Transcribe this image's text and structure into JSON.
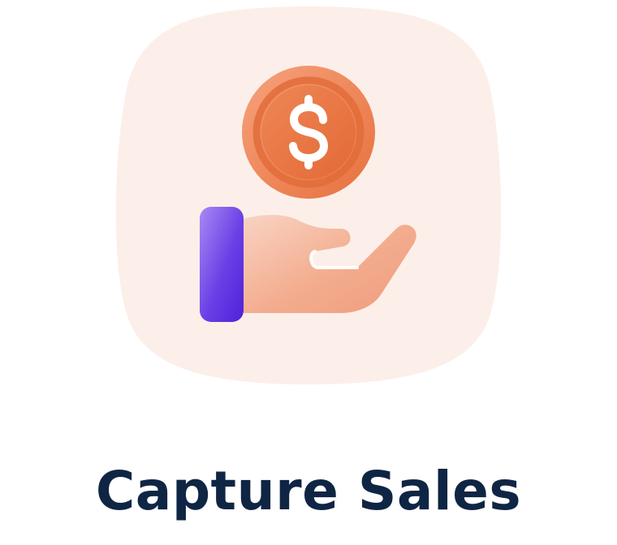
{
  "card": {
    "title": "Capture Sales",
    "icon": "hand-holding-dollar-coin-icon",
    "coin_symbol": "$"
  },
  "colors": {
    "title": "#0f2544",
    "blob_background": "#fcefe9",
    "coin_outer": "#ee8a5c",
    "coin_inner": "#e7703d",
    "coin_symbol": "#ffffff",
    "hand": "#f2a98a",
    "sleeve_light": "#9b7df2",
    "sleeve_dark": "#5b2fe0"
  }
}
